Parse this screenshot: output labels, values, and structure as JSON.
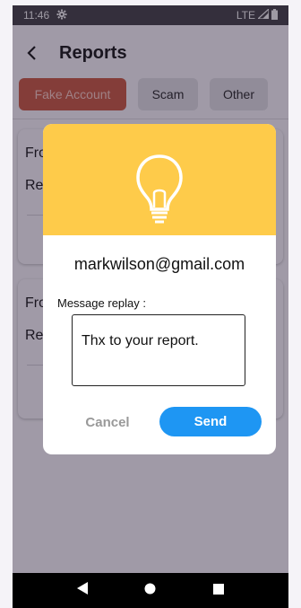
{
  "status_bar": {
    "time": "11:46",
    "network": "LTE"
  },
  "header": {
    "title": "Reports"
  },
  "filters": [
    {
      "label": "Fake Account",
      "active": true
    },
    {
      "label": "Scam",
      "active": false
    },
    {
      "label": "Other",
      "active": false
    }
  ],
  "cards": [
    {
      "from_label": "Fro",
      "reason_label": "Re"
    },
    {
      "from_label": "Fro",
      "reason_label": "Re"
    }
  ],
  "dialog": {
    "icon": "lightbulb-icon",
    "email": "markwilson@gmail.com",
    "message_label": "Message replay :",
    "message_value": "Thx to your report.",
    "cancel_label": "Cancel",
    "send_label": "Send"
  },
  "colors": {
    "accent_orange": "#c6543b",
    "dialog_header": "#fecb4a",
    "send_button": "#1e96f3"
  }
}
